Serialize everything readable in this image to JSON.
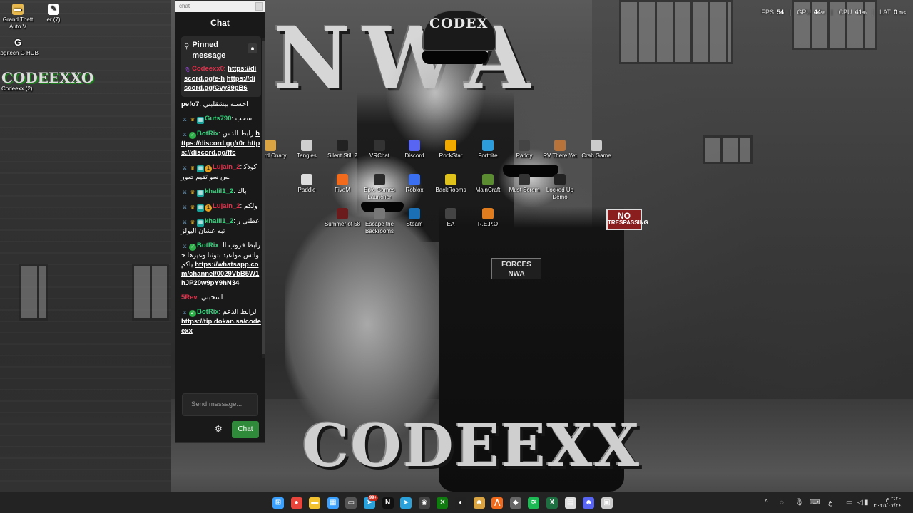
{
  "desktop_left": [
    {
      "label": "Grand Theft Auto V",
      "icon": "folder-icon"
    },
    {
      "label": "er (7)",
      "icon": "app-icon"
    },
    {
      "label": "Logitech G HUB",
      "icon": "logitech-icon"
    },
    {
      "label": "Codeexx (2)",
      "icon": "codeexx-logo-icon"
    }
  ],
  "codeexx_logo_text": "CODEEXXO",
  "desktop_icons": [
    {
      "label": "iscord Cnary",
      "icon": "discord-canary-icon",
      "color": "#d9a441"
    },
    {
      "label": "Tangles",
      "icon": "tangles-icon",
      "color": "#cfcfcf"
    },
    {
      "label": "Silent Still 2",
      "icon": "silent-still-icon",
      "color": "#222222"
    },
    {
      "label": "VRChat",
      "icon": "vrchat-icon",
      "color": "#333333"
    },
    {
      "label": "Discord",
      "icon": "discord-icon",
      "color": "#5865f2"
    },
    {
      "label": "RockStar",
      "icon": "rockstar-icon",
      "color": "#f2a900"
    },
    {
      "label": "Fortnite",
      "icon": "fortnite-icon",
      "color": "#2d9cdb"
    },
    {
      "label": "Paddy",
      "icon": "paddy-icon",
      "color": "#444444"
    },
    {
      "label": "RV There Yet",
      "icon": "rv-icon",
      "color": "#b8733a"
    },
    {
      "label": "Crab Game",
      "icon": "crab-game-icon",
      "color": "#cccccc"
    },
    {
      "label": "Paddle",
      "icon": "paddle-icon",
      "color": "#dddddd"
    },
    {
      "label": "FiveM",
      "icon": "fivem-icon",
      "color": "#f26b1d"
    },
    {
      "label": "Epic Games Launcher",
      "icon": "epic-games-icon",
      "color": "#2b2b2b"
    },
    {
      "label": "Roblox",
      "icon": "roblox-icon",
      "color": "#3b6ff2"
    },
    {
      "label": "BackRooms",
      "icon": "backrooms-icon",
      "color": "#e0c21d"
    },
    {
      "label": "MainCraft",
      "icon": "minecraft-icon",
      "color": "#5b8c32"
    },
    {
      "label": "Must Screm",
      "icon": "must-scream-icon",
      "color": "#333333"
    },
    {
      "label": "Locked Up Demo",
      "icon": "locked-up-icon",
      "color": "#222222"
    },
    {
      "label": "Summer of 58",
      "icon": "summer-of-58-icon",
      "color": "#6b1b1b"
    },
    {
      "label": "Escape the Backrooms",
      "icon": "escape-backrooms-icon",
      "color": "#777777"
    },
    {
      "label": "Steam",
      "icon": "steam-icon",
      "color": "#1b6fb5"
    },
    {
      "label": "EA",
      "icon": "ea-icon",
      "color": "#444444"
    },
    {
      "label": "R.E.P.O",
      "icon": "repo-icon",
      "color": "#e07c1d"
    }
  ],
  "wallpaper": {
    "title": "NWA",
    "bottom_title": "CODEEXX",
    "cap_text": "CODEX",
    "patch_line1": "FORCES",
    "patch_line2": "NWA",
    "sign_line1": "NO",
    "sign_line2": "TRESPASSING"
  },
  "chat": {
    "window_title": "chat",
    "header": "Chat",
    "pinned": {
      "title": "Pinned message",
      "user": "Codeexx0",
      "links": [
        "https://discord.gg/e-h",
        "https://discord.gg/Cvy39pB6"
      ]
    },
    "messages": [
      {
        "user": "pefo7",
        "user_color": "#ffffff",
        "badges": [],
        "text": "احسبه بيشقلبني"
      },
      {
        "user": "Guts790",
        "user_color": "#34d17a",
        "badges": [
          "sword",
          "crown",
          "grid"
        ],
        "text": "اسحب"
      },
      {
        "user": "BotRix",
        "user_color": "#34d17a",
        "badges": [
          "sword",
          "check"
        ],
        "text": "رابط الدس",
        "link": "https://discord.gg/r0r https://discord.gg/ffc"
      },
      {
        "user": "Lujain_2",
        "user_color": "#e0304a",
        "badges": [
          "sword",
          "crown",
          "grid",
          "one"
        ],
        "text": "كودكس سو تقيم صور"
      },
      {
        "user": "khalil1_2",
        "user_color": "#34d17a",
        "badges": [
          "sword",
          "crown",
          "grid"
        ],
        "text": "باك"
      },
      {
        "user": "Lujain_2",
        "user_color": "#e0304a",
        "badges": [
          "sword",
          "crown",
          "grid",
          "one"
        ],
        "text": "ولكم"
      },
      {
        "user": "khalil1_2",
        "user_color": "#34d17a",
        "badges": [
          "sword",
          "crown",
          "grid"
        ],
        "text": "عطني رتبه عشان اليولز"
      },
      {
        "user": "BotRix",
        "user_color": "#34d17a",
        "badges": [
          "sword",
          "check"
        ],
        "text": "رابط قروب الواتس مواعيد بثوثنا وغيرها حياكم",
        "link": "https://whatsapp.com/channel/0029VbB5W1hJP20w9pY9hN34"
      },
      {
        "user": "5Rev",
        "user_color": "#e0304a",
        "badges": [],
        "text": "اسحبني"
      },
      {
        "user": "BotRix",
        "user_color": "#34d17a",
        "badges": [
          "sword",
          "check"
        ],
        "text": "لرابط الدعم",
        "link": "https://tip.dokan.sa/codeexx"
      }
    ],
    "input_placeholder": "Send message...",
    "send_label": "Chat"
  },
  "perf": {
    "fps_label": "FPS",
    "fps": "54",
    "gpu_label": "GPU",
    "gpu": "44",
    "cpu_label": "CPU",
    "cpu": "41",
    "lat_label": "LAT",
    "lat": "0"
  },
  "taskbar": {
    "apps": [
      {
        "name": "windows-start",
        "color": "#3aa0ff",
        "glyph": "⊞"
      },
      {
        "name": "chrome",
        "color": "#e8453c",
        "glyph": "●"
      },
      {
        "name": "file-explorer",
        "color": "#f2c230",
        "glyph": "▬"
      },
      {
        "name": "store",
        "color": "#3aa0ff",
        "glyph": "▦"
      },
      {
        "name": "phone-link",
        "color": "#555555",
        "glyph": "▭"
      },
      {
        "name": "telegram",
        "color": "#2aa1da",
        "glyph": "➤"
      },
      {
        "name": "netflix",
        "color": "#101010",
        "glyph": "N"
      },
      {
        "name": "telegram-2",
        "color": "#2aa1da",
        "glyph": "➤"
      },
      {
        "name": "obs",
        "color": "#444444",
        "glyph": "◉"
      },
      {
        "name": "xbox",
        "color": "#107c10",
        "glyph": "✕"
      },
      {
        "name": "capcut",
        "color": "#222222",
        "glyph": "◐"
      },
      {
        "name": "discord-canary",
        "color": "#d9a441",
        "glyph": "☻"
      },
      {
        "name": "fivem",
        "color": "#f26b1d",
        "glyph": "⋀"
      },
      {
        "name": "game",
        "color": "#666666",
        "glyph": "◆"
      },
      {
        "name": "spotify",
        "color": "#1db954",
        "glyph": "≋"
      },
      {
        "name": "excel",
        "color": "#1d6f42",
        "glyph": "X"
      },
      {
        "name": "notepad",
        "color": "#dddddd",
        "glyph": "▤"
      },
      {
        "name": "discord",
        "color": "#5865f2",
        "glyph": "☻"
      },
      {
        "name": "crab-game",
        "color": "#cccccc",
        "glyph": "▣"
      }
    ],
    "badge": "99+",
    "tray_chevron": "^",
    "time": "٢:٢٠ م",
    "date": "٢٠٢٥/٠٧/٢٤",
    "lang": "ع"
  }
}
